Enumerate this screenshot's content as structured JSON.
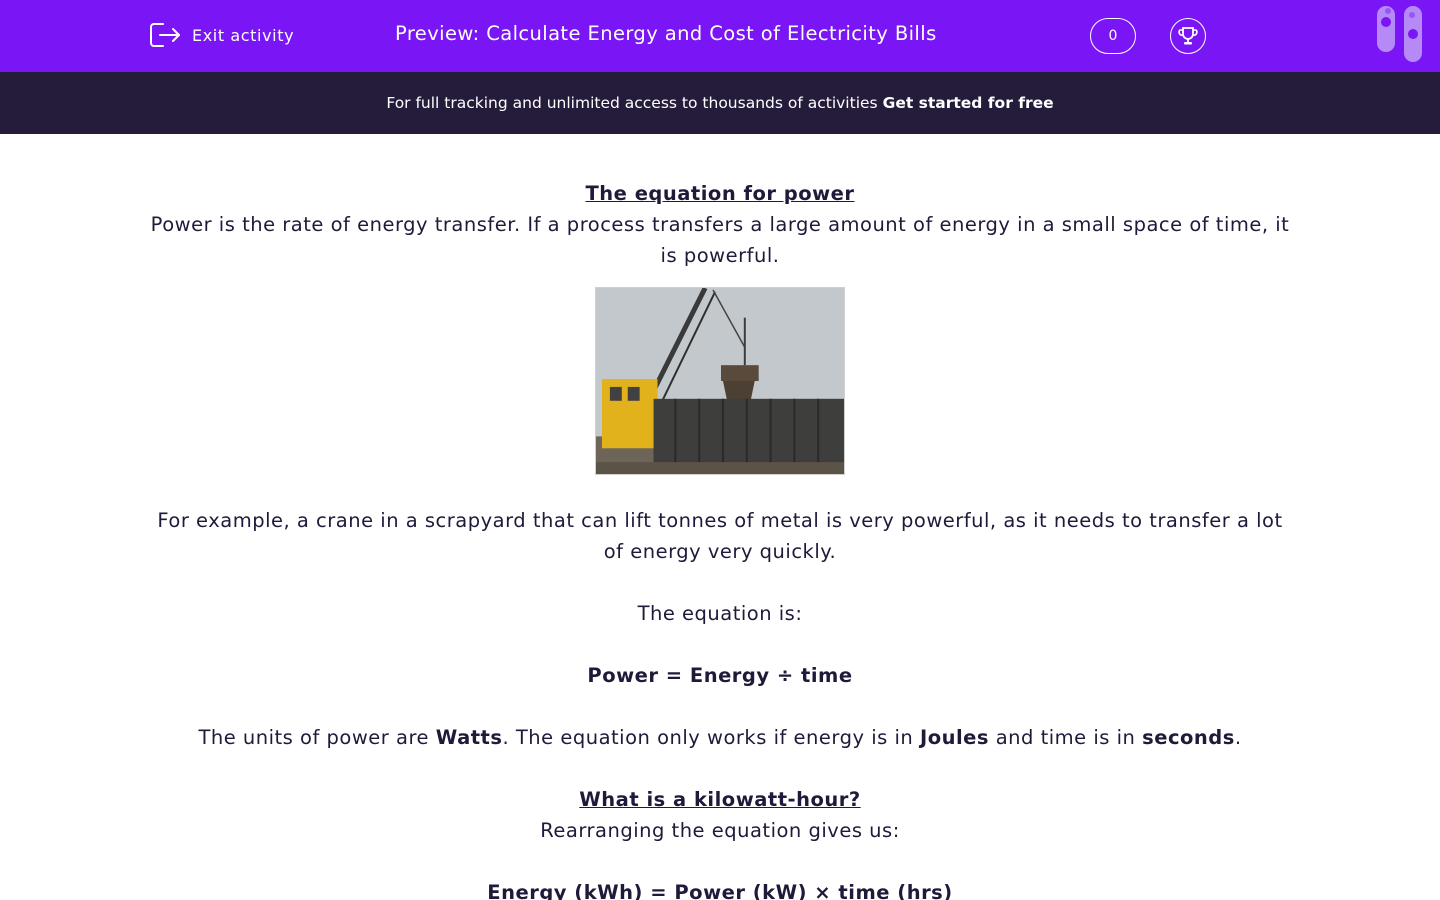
{
  "header": {
    "exit_label": "Exit activity",
    "title": "Preview: Calculate Energy and Cost of Electricity Bills",
    "score": "0",
    "brand_color": "#7a16f5"
  },
  "banner": {
    "text": "For full tracking and unlimited access to thousands of activities",
    "cta": "Get started for free",
    "bg_color": "#251c3b"
  },
  "content": {
    "heading1": "The equation for power",
    "intro": "Power is the rate of energy transfer. If a process transfers a large amount of energy in a small space of time, it is powerful.",
    "image_icon": "crane-scrapyard-photo",
    "example": "For example, a crane in a scrapyard that can lift tonnes of metal is very powerful, as it needs to transfer a lot of energy very quickly.",
    "equation_intro": "The equation is:",
    "equation": "Power = Energy ÷ time",
    "units_text_1": "The units of power are ",
    "units_bold_1": "Watts",
    "units_text_2": ". The equation only works if energy is in ",
    "units_bold_2": "Joules",
    "units_text_3": " and time is in ",
    "units_bold_3": "seconds",
    "units_text_4": ".",
    "heading2": "What is a kilowatt-hour?",
    "rearrange": "Rearranging the equation gives us:",
    "rearranged_equation": "Energy (kWh) = Power (kW) × time (hrs)"
  }
}
